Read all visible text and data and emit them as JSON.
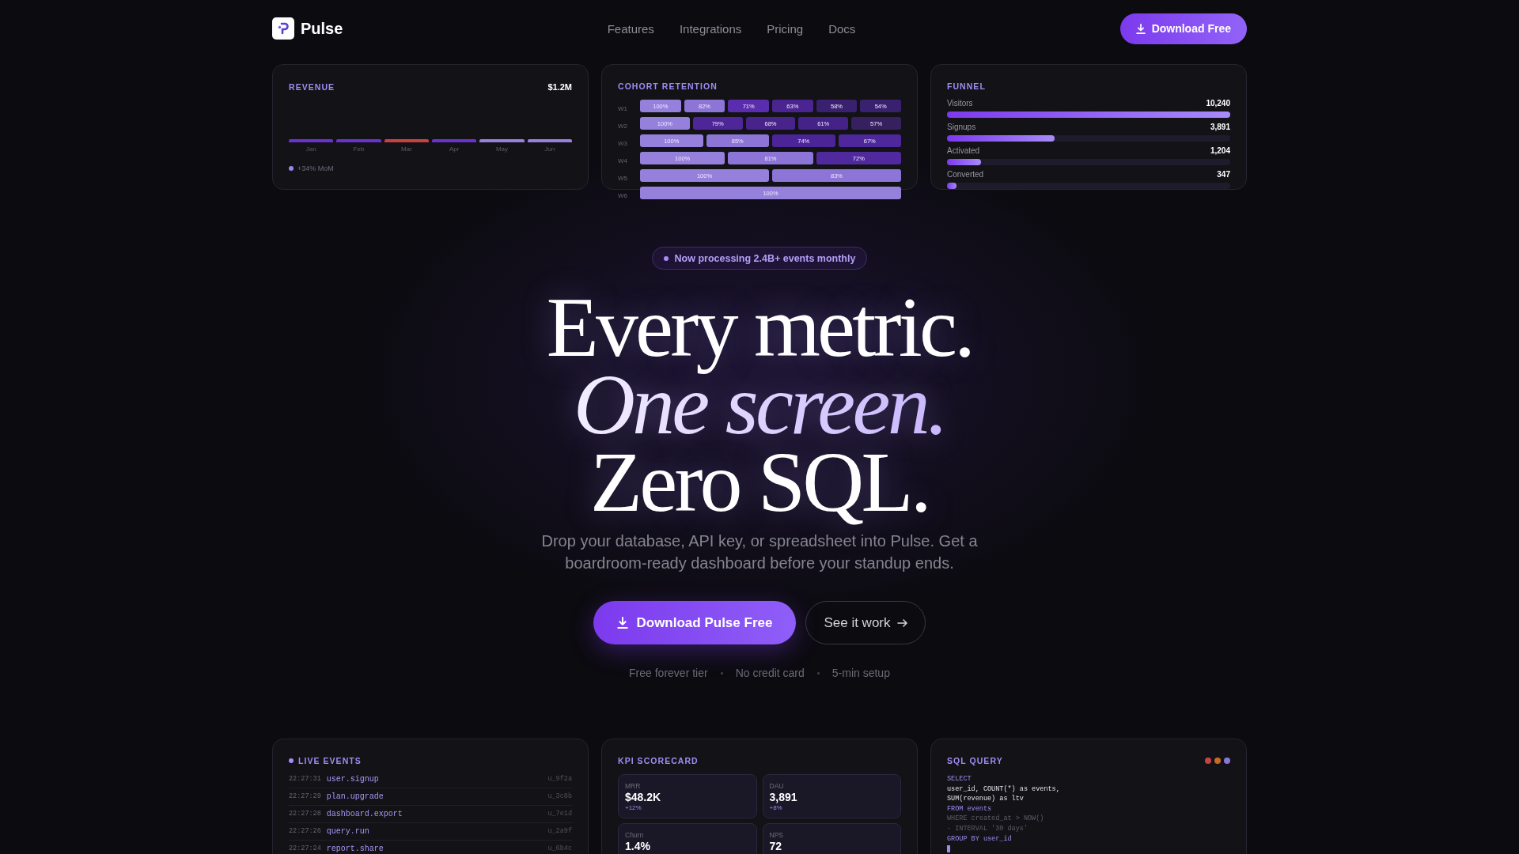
{
  "nav": {
    "brand": "Pulse",
    "links": [
      "Features",
      "Integrations",
      "Pricing",
      "Docs"
    ],
    "cta": "Download Free"
  },
  "top_cards": {
    "revenue": {
      "title": "REVENUE",
      "total": "$1.2M",
      "months": [
        {
          "label": "Jan",
          "color": "#6b30d0"
        },
        {
          "label": "Feb",
          "color": "#6b30d0"
        },
        {
          "label": "Mar",
          "color": "#c94040"
        },
        {
          "label": "Apr",
          "color": "#6b30d0"
        },
        {
          "label": "May",
          "color": "#9580dc"
        },
        {
          "label": "Jun",
          "color": "#9580dc"
        }
      ],
      "trend": "+34% MoM"
    },
    "cohort": {
      "title": "COHORT RETENTION",
      "rows": [
        {
          "label": "W1",
          "cells": [
            {
              "value": "100%",
              "color": "#9580dc"
            },
            {
              "value": "82%",
              "color": "#8c75d6"
            },
            {
              "value": "71%",
              "color": "#5a2cae"
            },
            {
              "value": "63%",
              "color": "#4a2592"
            },
            {
              "value": "58%",
              "color": "#3a2170"
            },
            {
              "value": "54%",
              "color": "#3a2170"
            }
          ]
        },
        {
          "label": "W2",
          "cells": [
            {
              "value": "100%",
              "color": "#9580dc"
            },
            {
              "value": "79%",
              "color": "#4e2698"
            },
            {
              "value": "68%",
              "color": "#47238a"
            },
            {
              "value": "61%",
              "color": "#452287"
            },
            {
              "value": "57%",
              "color": "#37205f"
            }
          ]
        },
        {
          "label": "W3",
          "cells": [
            {
              "value": "100%",
              "color": "#9580dc"
            },
            {
              "value": "85%",
              "color": "#8c75d6"
            },
            {
              "value": "74%",
              "color": "#4b2497"
            },
            {
              "value": "67%",
              "color": "#4e279c"
            }
          ]
        },
        {
          "label": "W4",
          "cells": [
            {
              "value": "100%",
              "color": "#9580dc"
            },
            {
              "value": "81%",
              "color": "#8c75d6"
            },
            {
              "value": "72%",
              "color": "#50299e"
            }
          ]
        },
        {
          "label": "W5",
          "cells": [
            {
              "value": "100%",
              "color": "#9580dc"
            },
            {
              "value": "83%",
              "color": "#8c75d6"
            }
          ]
        },
        {
          "label": "W6",
          "cells": [
            {
              "value": "100%",
              "color": "#9580dc"
            }
          ]
        }
      ]
    },
    "funnel": {
      "title": "FUNNEL",
      "steps": [
        {
          "label": "Visitors",
          "value": "10,240",
          "level": 1
        },
        {
          "label": "Signups",
          "value": "3,891",
          "level": 0.38
        },
        {
          "label": "Activated",
          "value": "1,204",
          "level": 0.12
        },
        {
          "label": "Converted",
          "value": "347",
          "level": 0.034
        }
      ]
    }
  },
  "hero": {
    "badge": "Now processing 2.4B+ events monthly",
    "headline": [
      {
        "text": "Every metric.",
        "kind": "plain"
      },
      {
        "text": "One screen.",
        "kind": "accent"
      },
      {
        "text": "Zero SQL.",
        "kind": "plain"
      }
    ],
    "subtitle": "Drop your database, API key, or spreadsheet into Pulse. Get a boardroom-ready dashboard before your standup ends.",
    "buttons": [
      {
        "label": "Download Pulse Free",
        "kind": "primary"
      },
      {
        "label": "See it work",
        "kind": "secondary"
      }
    ],
    "perks": [
      "Free forever tier",
      "No credit card",
      "5-min setup"
    ]
  },
  "bottom_cards": {
    "live_events": {
      "title": "LIVE EVENTS",
      "events": [
        {
          "time": "22:27:31",
          "name": "user.signup",
          "user": "u_9f2a"
        },
        {
          "time": "22:27:29",
          "name": "plan.upgrade",
          "user": "u_3c8b"
        },
        {
          "time": "22:27:28",
          "name": "dashboard.export",
          "user": "u_7e1d"
        },
        {
          "time": "22:27:26",
          "name": "query.run",
          "user": "u_2a9f"
        },
        {
          "time": "22:27:24",
          "name": "report.share",
          "user": "u_6b4c"
        }
      ]
    },
    "kpi": {
      "title": "KPI SCORECARD",
      "tiles": [
        {
          "label": "MRR",
          "value": "$48.2K",
          "delta": "+12%"
        },
        {
          "label": "DAU",
          "value": "3,891",
          "delta": "+8%"
        },
        {
          "label": "Churn",
          "value": "1.4%"
        },
        {
          "label": "NPS",
          "value": "72"
        }
      ]
    },
    "sql": {
      "title": "SQL QUERY",
      "dots": [
        {
          "color": "#c64343"
        },
        {
          "color": "#c8691f"
        },
        {
          "color": "#8877d5"
        }
      ],
      "lines": [
        {
          "text": "SELECT",
          "kind": "keyword"
        },
        {
          "text": "user_id, COUNT(*) as events,",
          "kind": "plain"
        },
        {
          "text": "SUM(revenue) as ltv",
          "kind": "plain"
        },
        {
          "text": "FROM events",
          "kind": "keyword"
        },
        {
          "text": "WHERE created_at > NOW()",
          "kind": "dim"
        },
        {
          "text": "- INTERVAL '30 days'",
          "kind": "dim"
        },
        {
          "text": "GROUP BY user_id",
          "kind": "keyword"
        }
      ],
      "cursor": true
    }
  }
}
